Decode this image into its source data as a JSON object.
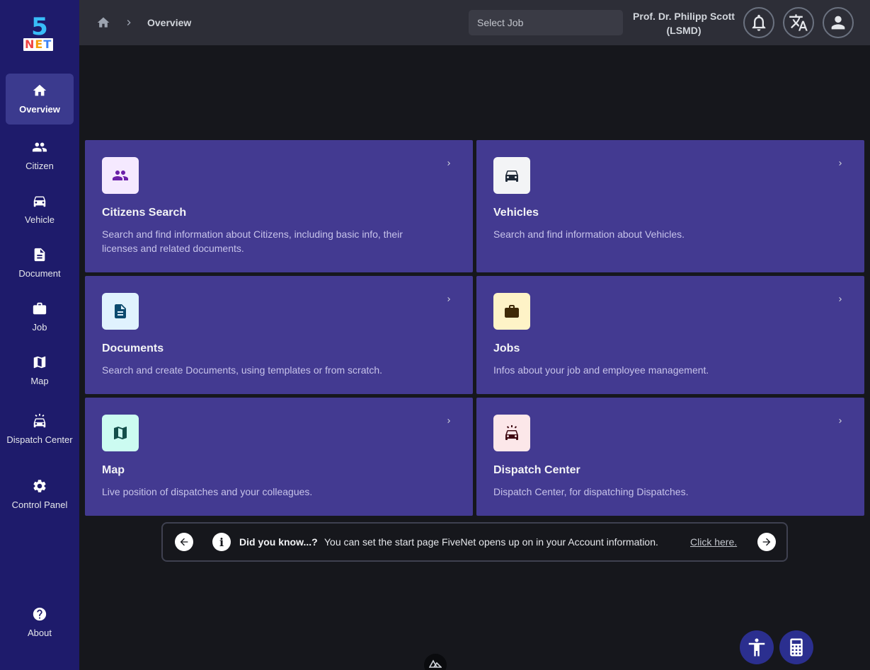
{
  "app": {
    "logo_digit": "5",
    "logo_text_1": "N",
    "logo_text_2": "E",
    "logo_text_3": "T"
  },
  "sidebar": {
    "items": [
      {
        "label": "Overview",
        "icon": "home-icon",
        "active": true
      },
      {
        "label": "Citizen",
        "icon": "users-icon"
      },
      {
        "label": "Vehicle",
        "icon": "car-icon"
      },
      {
        "label": "Document",
        "icon": "document-icon"
      },
      {
        "label": "Job",
        "icon": "briefcase-icon"
      },
      {
        "label": "Map",
        "icon": "map-icon"
      },
      {
        "label": "Dispatch Center",
        "icon": "car-emergency-icon"
      },
      {
        "label": "Control Panel",
        "icon": "gear-icon"
      }
    ],
    "about": {
      "label": "About",
      "icon": "help-circle-icon"
    }
  },
  "header": {
    "breadcrumb_current": "Overview",
    "job_select_placeholder": "Select Job",
    "user_name": "Prof. Dr. Philipp Scott (LSMD)"
  },
  "cards": [
    {
      "title": "Citizens Search",
      "desc": "Search and find information about Citizens, including basic info, their licenses and related documents.",
      "icon": "users-icon",
      "icon_bg": "#f5e9ff",
      "icon_color": "#6b21a8"
    },
    {
      "title": "Vehicles",
      "desc": "Search and find information about Vehicles.",
      "icon": "car-icon",
      "icon_bg": "#f3f4f6",
      "icon_color": "#1f2937"
    },
    {
      "title": "Documents",
      "desc": "Search and create Documents, using templates or from scratch.",
      "icon": "document-icon",
      "icon_bg": "#e0f2fe",
      "icon_color": "#0c4a6e"
    },
    {
      "title": "Jobs",
      "desc": "Infos about your job and employee management.",
      "icon": "briefcase-icon",
      "icon_bg": "#fef3c7",
      "icon_color": "#3f2a06"
    },
    {
      "title": "Map",
      "desc": "Live position of dispatches and your colleagues.",
      "icon": "map-icon",
      "icon_bg": "#ccfbf1",
      "icon_color": "#134e4a"
    },
    {
      "title": "Dispatch Center",
      "desc": "Dispatch Center, for dispatching Dispatches.",
      "icon": "car-emergency-icon",
      "icon_bg": "#fce7e9",
      "icon_color": "#3f0a12"
    }
  ],
  "tip": {
    "title": "Did you know...?",
    "text": "You can set the start page FiveNet opens up on in your Account information.",
    "link": "Click here."
  },
  "colors": {
    "sidebar_bg": "#1e1b6b",
    "card_bg": "#433a91",
    "header_bg": "#2d2e37",
    "page_bg": "#16171c"
  }
}
